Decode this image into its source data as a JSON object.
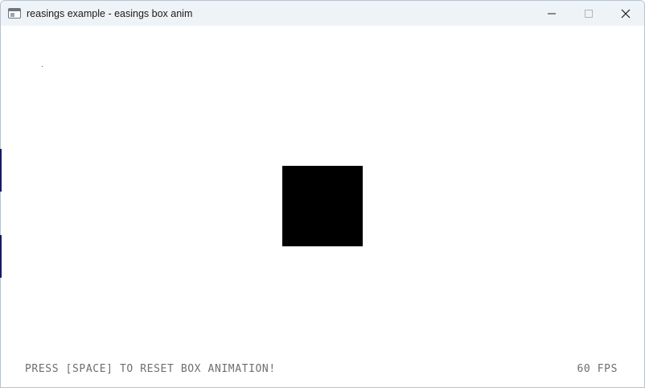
{
  "window": {
    "title": "reasings example - easings box anim",
    "controls": {
      "minimize": "minimize-icon",
      "maximize": "maximize-icon",
      "close": "close-icon"
    }
  },
  "canvas": {
    "instructions": "PRESS [SPACE] TO RESET BOX ANIMATION!",
    "fps": "60 FPS",
    "box_color": "#000000",
    "text_color": "#6e6e6e",
    "background": "#ffffff"
  }
}
